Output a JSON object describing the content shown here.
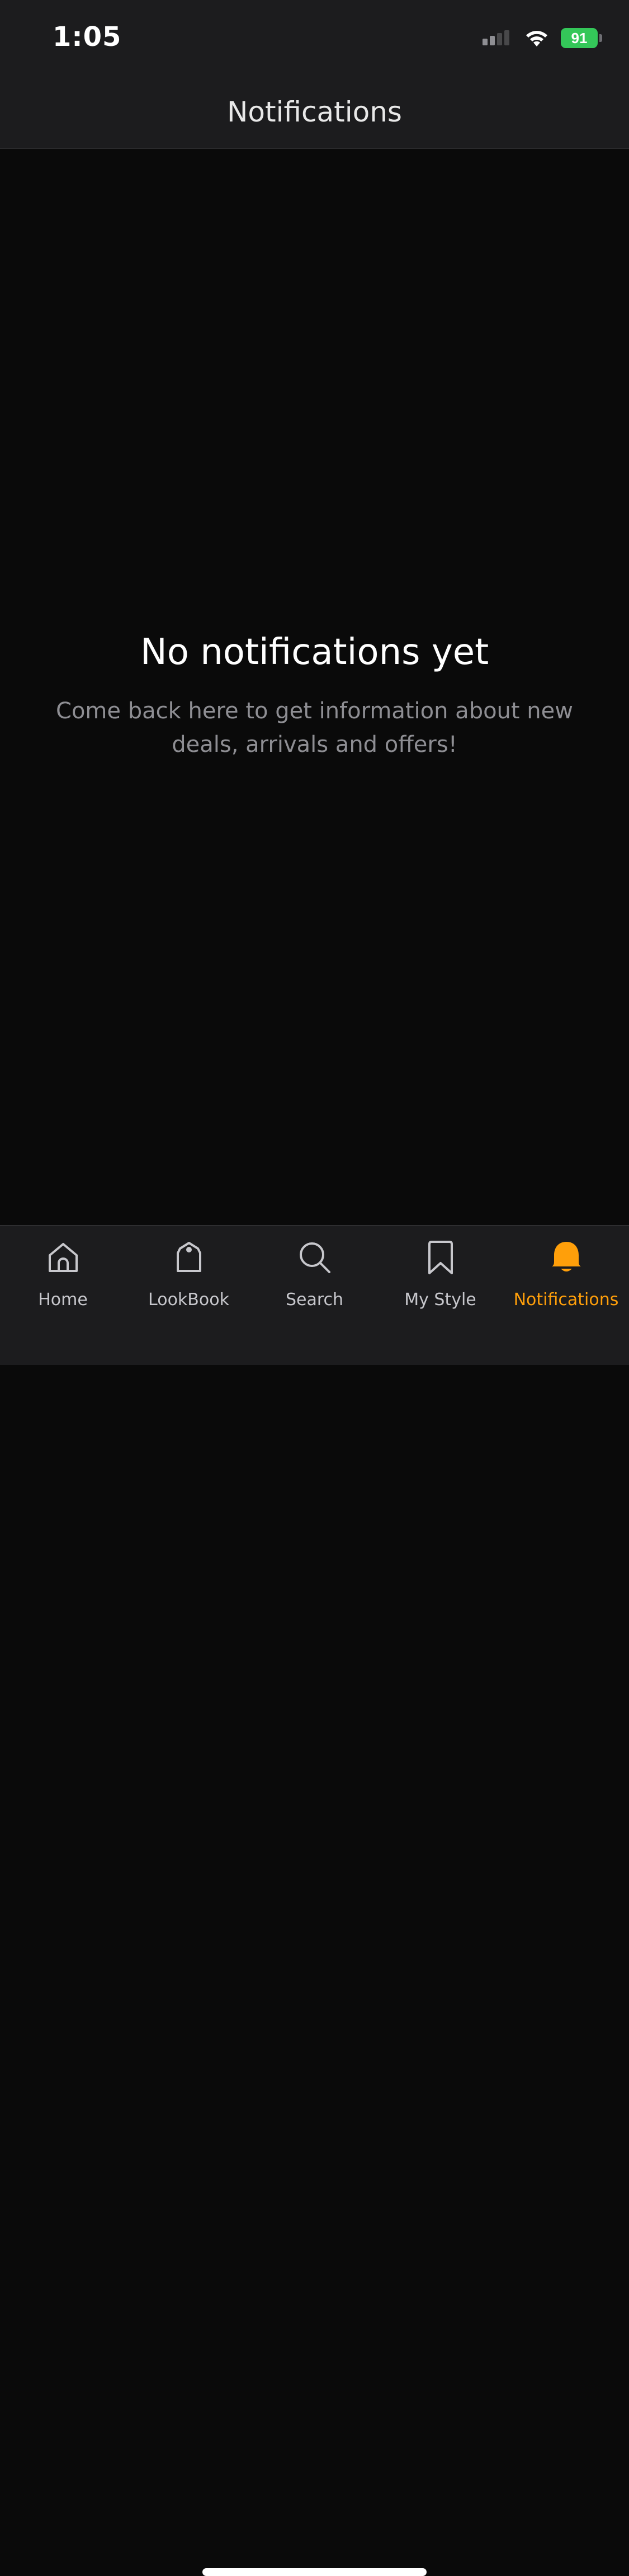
{
  "status_bar": {
    "time": "1:05",
    "battery_level": "91",
    "battery_color": "#34c759"
  },
  "header": {
    "title": "Notifications"
  },
  "empty_state": {
    "title": "No notifications yet",
    "subtitle": "Come back here to get information about new deals, arrivals and offers!"
  },
  "tab_bar": {
    "active_color": "#ff9f0a",
    "items": [
      {
        "label": "Home",
        "icon": "home-icon"
      },
      {
        "label": "LookBook",
        "icon": "tag-icon"
      },
      {
        "label": "Search",
        "icon": "search-icon"
      },
      {
        "label": "My Style",
        "icon": "bookmark-icon"
      },
      {
        "label": "Notifications",
        "icon": "bell-icon",
        "active": true
      }
    ]
  }
}
